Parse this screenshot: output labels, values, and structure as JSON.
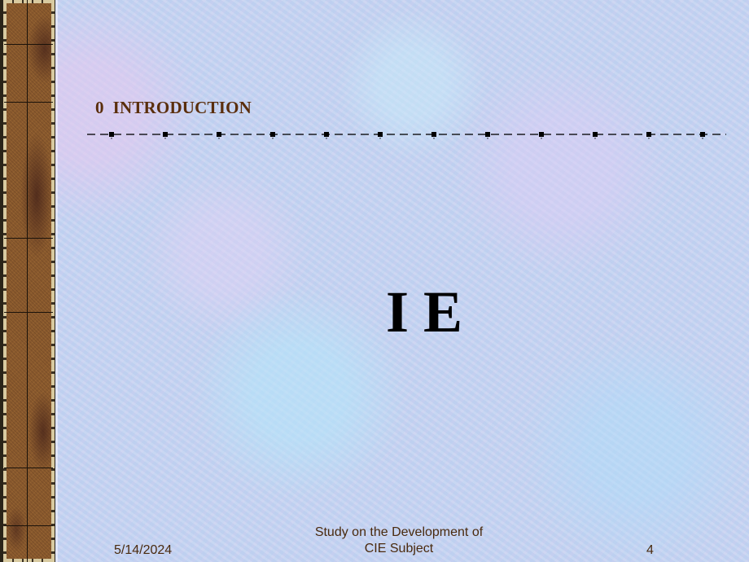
{
  "slide": {
    "heading": "0  INTRODUCTION",
    "main_text": "I E",
    "colors": {
      "heading": "#5a2e0c",
      "main_text": "#000000",
      "footer": "#4a2a0e",
      "rule": "#000000"
    }
  },
  "footer": {
    "date": "5/14/2024",
    "title_line1": "Study on the Development of",
    "title_line2": "CIE Subject",
    "page_number": "4"
  },
  "decor": {
    "left_panel_icon": "parchment-leaf-border",
    "rule_icon": "dashed-line-with-square-markers"
  }
}
